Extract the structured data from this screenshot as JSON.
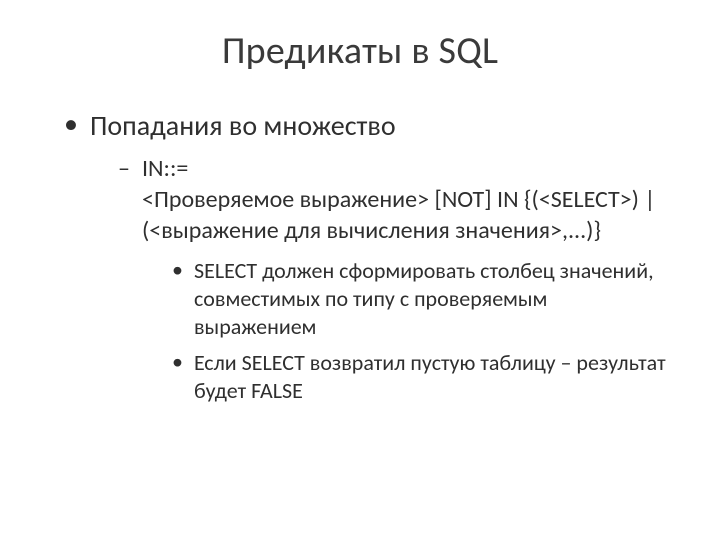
{
  "title": "Предикаты в SQL",
  "bullet1": "Попадания во множество",
  "sub1": "IN::=\n<Проверяемое выражение> [NOT] IN {(<SELECT>) | (<выражение для вычисления значения>,...)}",
  "subsub1": "SELECT должен сформировать столбец значений, совместимых по типу с проверяемым выражением",
  "subsub2": "Если SELECT возвратил пустую таблицу – результат будет FALSE"
}
